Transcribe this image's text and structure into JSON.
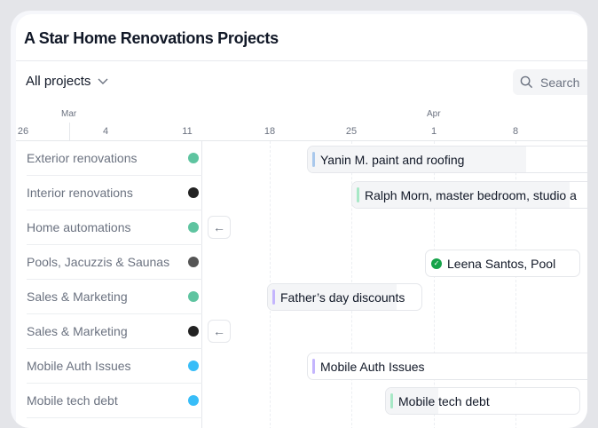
{
  "title": "A Star Home Renovations Projects",
  "filter": {
    "label": "All projects"
  },
  "search": {
    "placeholder": "Search"
  },
  "timeline": {
    "months": [
      {
        "label": "Mar"
      },
      {
        "label": "Apr"
      }
    ],
    "days": [
      "26",
      "4",
      "11",
      "18",
      "25",
      "1",
      "8"
    ]
  },
  "rows": [
    {
      "label": "Exterior renovations",
      "avatar": "#5ec4a0"
    },
    {
      "label": "Interior renovations",
      "avatar": "#222"
    },
    {
      "label": "Home automations",
      "avatar": "#5ec4a0"
    },
    {
      "label": "Pools, Jacuzzis & Saunas",
      "avatar": "#555"
    },
    {
      "label": "Sales & Marketing",
      "avatar": "#5ec4a0"
    },
    {
      "label": "Sales & Marketing",
      "avatar": "#222"
    },
    {
      "label": "Mobile Auth Issues",
      "avatar": "#38bdf8"
    },
    {
      "label": "Mobile tech debt",
      "avatar": "#38bdf8"
    }
  ],
  "bars": [
    {
      "label": "Yanin M. paint and roofing",
      "accent": "#a9c8ec",
      "progress": 0.75
    },
    {
      "label": "Ralph Morn, master bedroom, studio a",
      "accent": "#a7e8c6",
      "progress": 0.88
    },
    {
      "label": "Leena Santos, Pool",
      "status": "done",
      "accent": "#16a34a",
      "progress": 0
    },
    {
      "label": "Father’s day discounts",
      "accent": "#c4b5fd",
      "progress": 0.84
    },
    {
      "label": "Mobile Auth Issues",
      "accent": "#c4b5fd",
      "progress": 0
    },
    {
      "label": "Mobile tech debt",
      "accent": "#a7e8c6",
      "progress": 0.27
    }
  ]
}
